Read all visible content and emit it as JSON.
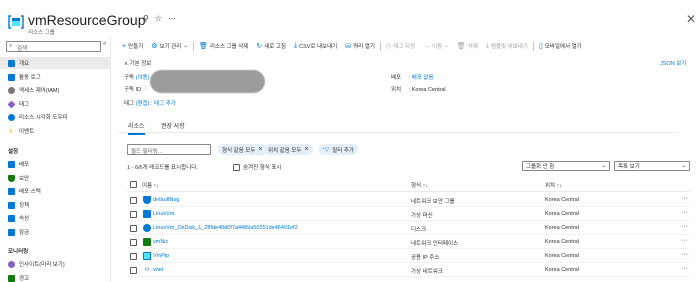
{
  "header": {
    "title": "vmResourceGroup",
    "subtitle": "리소스 그룹",
    "pin_icon": "pin-icon",
    "star_icon": "star-icon",
    "more_label": "···",
    "close_label": "✕"
  },
  "sidebar": {
    "search_placeholder": "검색",
    "collapse_label": "«",
    "items": [
      {
        "label": "개요",
        "icon": "overview-icon",
        "color": "#0078d4"
      },
      {
        "label": "활동 로그",
        "icon": "activity-log-icon",
        "color": "#0078d4"
      },
      {
        "label": "액세스 제어(IAM)",
        "icon": "iam-icon",
        "color": "#7a7574"
      },
      {
        "label": "태그",
        "icon": "tag-icon",
        "color": "#8661c5"
      },
      {
        "label": "리소스 시각화 도우미",
        "icon": "visualizer-icon",
        "color": "#0078d4"
      },
      {
        "label": "이벤트",
        "icon": "events-icon",
        "color": "#ffb900"
      }
    ],
    "section_settings": "설정",
    "settings_items": [
      {
        "label": "배포",
        "icon": "deployments-icon",
        "color": "#0078d4"
      },
      {
        "label": "보안",
        "icon": "security-icon",
        "color": "#107c10"
      },
      {
        "label": "배포 스택",
        "icon": "deployment-stack-icon",
        "color": "#0078d4"
      },
      {
        "label": "정책",
        "icon": "policy-icon",
        "color": "#0078d4"
      },
      {
        "label": "속성",
        "icon": "properties-icon",
        "color": "#0078d4"
      },
      {
        "label": "잠금",
        "icon": "lock-icon",
        "color": "#0078d4"
      }
    ],
    "section_monitoring": "모니터링",
    "monitoring_items": [
      {
        "label": "인사이트(미리 보기)",
        "icon": "insights-icon",
        "color": "#8661c5"
      },
      {
        "label": "경고",
        "icon": "alerts-icon",
        "color": "#107c10"
      }
    ]
  },
  "toolbar": {
    "items": [
      {
        "label": "만들기",
        "icon": "+",
        "disabled": false
      },
      {
        "label": "보기 관리",
        "icon": "⚙",
        "disabled": false,
        "dropdown": true
      },
      {
        "label": "리소스 그룹 삭제",
        "icon": "🗑",
        "disabled": false
      },
      {
        "label": "새로 고침",
        "icon": "↻",
        "disabled": false
      },
      {
        "label": "CSV로 내보내기",
        "icon": "⤓",
        "disabled": false
      },
      {
        "label": "쿼리 열기",
        "icon": "⛁",
        "disabled": false
      },
      {
        "label": "태그 지정",
        "icon": "◇",
        "disabled": true
      },
      {
        "label": "이동",
        "icon": "→",
        "disabled": true,
        "dropdown": true
      },
      {
        "label": "삭제",
        "icon": "🗑",
        "disabled": true
      },
      {
        "label": "템플릿 내보내기",
        "icon": "⤓",
        "disabled": true
      },
      {
        "label": "모바일에서 열기",
        "icon": "▯",
        "disabled": false
      }
    ]
  },
  "essentials": {
    "toggle_label": "∧ 기본 정보",
    "json_view": "JSON 보기",
    "subscription_label": "구독",
    "subscription_move": "(이동)",
    "subscription_colon": ":",
    "subscription_id_label": "구독 ID",
    "subscription_id_colon": ":",
    "deployments_label": "배포",
    "deployments_value": "배포 없음",
    "deployments_colon": ":",
    "location_label": "위치",
    "location_value": "Korea Central",
    "location_colon": ":",
    "tags_label": "태그",
    "tags_edit": "(편집)",
    "tags_colon": ":",
    "tags_add": "태그 추가"
  },
  "tabs": [
    {
      "label": "리소스",
      "selected": true
    },
    {
      "label": "권장 사항",
      "selected": false
    }
  ],
  "filters": {
    "filter_placeholder": "필드 필터링...",
    "pill_type": "형식 같음 모두",
    "pill_location": "위치 같음 모두",
    "add_filter": "필터 추가"
  },
  "list": {
    "record_count": "1 - 6/6개 레코드를 표시합니다.",
    "show_hidden": "숨겨진 형식 표시",
    "grouping_value": "그룹화 안 함",
    "view_value": "목록 보기",
    "col_name": "이름 ↑↓",
    "col_type": "형식 ↑↓",
    "col_location": "위치 ↑↓",
    "rows": [
      {
        "name": "defaultNsg",
        "type": "네트워크 보안 그룹",
        "location": "Korea Central",
        "icon": "nsg-icon",
        "color": "#0078d4"
      },
      {
        "name": "LinuxVm",
        "type": "가상 머신",
        "location": "Korea Central",
        "icon": "vm-icon",
        "color": "#0078d4"
      },
      {
        "name": "LinuxVm_OsDisk_1_28fde48d0f7a4489a50251de46491ef2",
        "type": "디스크",
        "location": "Korea Central",
        "icon": "disk-icon",
        "color": "#0078d4"
      },
      {
        "name": "vmNic",
        "type": "네트워크 인터페이스",
        "location": "Korea Central",
        "icon": "nic-icon",
        "color": "#107c10"
      },
      {
        "name": "VmPip",
        "type": "공용 IP 주소",
        "location": "Korea Central",
        "icon": "public-ip-icon",
        "color": "#0078d4"
      },
      {
        "name": "vnet",
        "type": "가상 네트워크",
        "location": "Korea Central",
        "icon": "vnet-icon",
        "color": "#0078d4"
      }
    ],
    "more_label": "···"
  }
}
